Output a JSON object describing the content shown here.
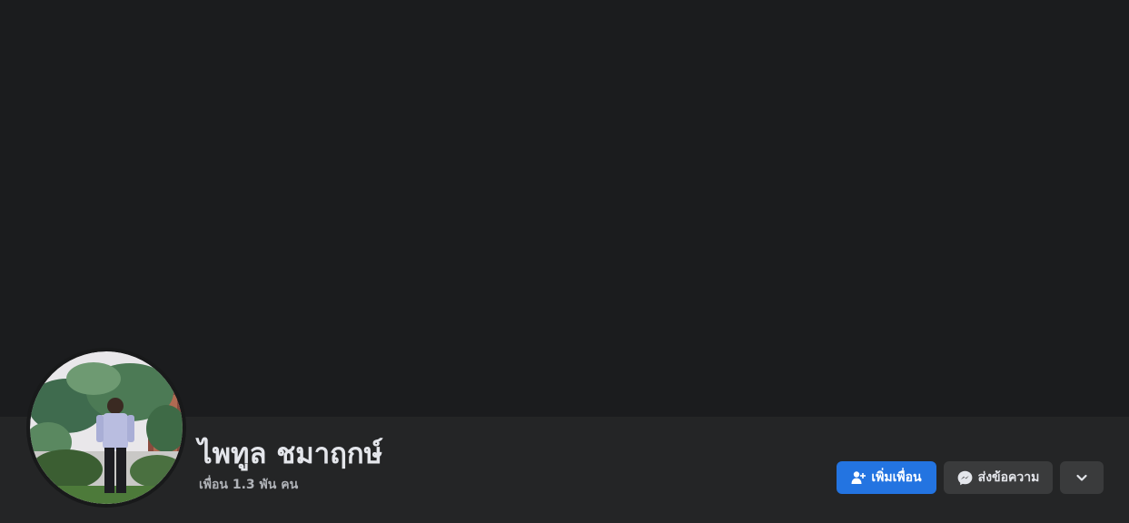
{
  "profile": {
    "name": "ไพทูล ชมาฤกษ์",
    "friends_text": "เพื่อน 1.3 พัน คน"
  },
  "actions": {
    "add_friend_label": "เพิ่มเพื่อน",
    "message_label": "ส่งข้อความ"
  },
  "icons": {
    "add_friend": "add-friend-icon",
    "messenger": "messenger-icon",
    "more": "chevron-down-icon"
  },
  "colors": {
    "background": "#18191a",
    "cover": "#1b1c1e",
    "profile_bar": "#242526",
    "primary_button": "#2374e1",
    "secondary_button": "#3a3b3c",
    "text_primary": "#e4e6eb",
    "text_secondary": "#b0b3b8"
  }
}
